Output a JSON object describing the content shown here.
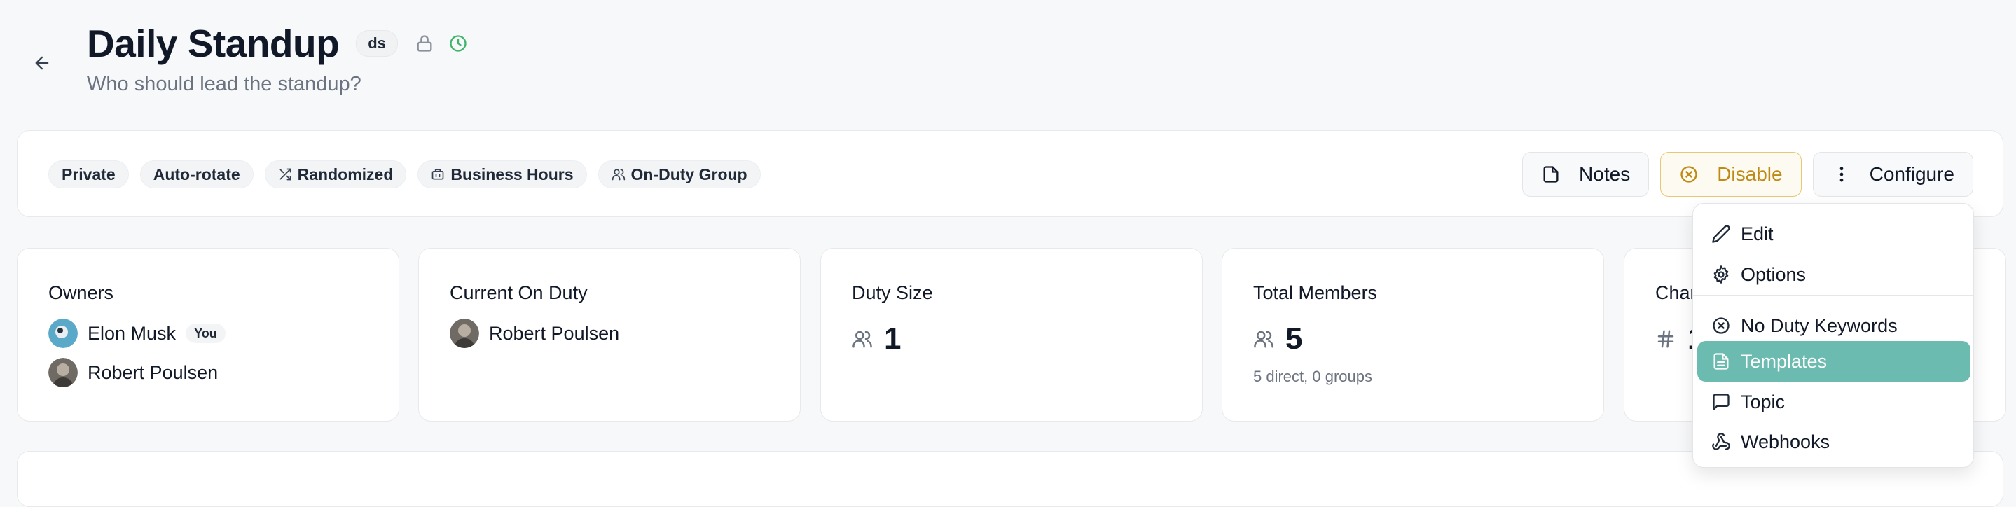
{
  "header": {
    "title": "Daily Standup",
    "slug": "ds",
    "subtitle": "Who should lead the standup?"
  },
  "tags": [
    "Private",
    "Auto-rotate",
    "Randomized",
    "Business Hours",
    "On-Duty Group"
  ],
  "actions": {
    "notes": "Notes",
    "disable": "Disable",
    "configure": "Configure"
  },
  "cards": {
    "owners": {
      "title": "Owners",
      "people": [
        {
          "name": "Elon Musk",
          "badge": "You"
        },
        {
          "name": "Robert Poulsen"
        }
      ]
    },
    "on_duty": {
      "title": "Current On Duty",
      "name": "Robert Poulsen"
    },
    "duty_size": {
      "title": "Duty Size",
      "value": "1"
    },
    "total_members": {
      "title": "Total Members",
      "value": "5",
      "sub": "5 direct, 0 groups"
    },
    "channels": {
      "title": "Char",
      "value": "1"
    }
  },
  "menu": {
    "items": [
      {
        "label": "Edit",
        "icon": "pencil-icon"
      },
      {
        "label": "Options",
        "icon": "gear-icon"
      },
      {
        "label": "No Duty Keywords",
        "icon": "x-circle-icon"
      },
      {
        "label": "Templates",
        "icon": "file-text-icon",
        "active": true
      },
      {
        "label": "Topic",
        "icon": "message-square-icon"
      },
      {
        "label": "Webhooks",
        "icon": "webhook-icon"
      }
    ]
  },
  "colors": {
    "accent_active": "#6bbbb0",
    "disable": "#bf8a14",
    "status_ok": "#3fb56a"
  }
}
